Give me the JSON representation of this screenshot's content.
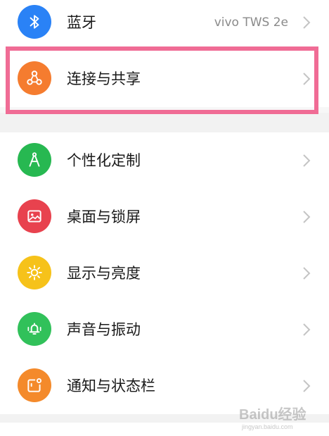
{
  "colors": {
    "bluetooth": "#2a82f6",
    "connection": "#f57c2f",
    "personalization": "#27b851",
    "desktop": "#e8424e",
    "display": "#f6c21a",
    "sound": "#31c15a",
    "notification": "#f48a2b",
    "highlight": "#f06c95"
  },
  "rows": [
    {
      "label": "蓝牙",
      "value": "vivo TWS 2e",
      "icon": "bluetooth-icon"
    },
    {
      "label": "连接与共享",
      "icon": "share-link-icon"
    },
    {
      "label": "个性化定制",
      "icon": "compass-icon"
    },
    {
      "label": "桌面与锁屏",
      "icon": "image-icon"
    },
    {
      "label": "显示与亮度",
      "icon": "sun-icon"
    },
    {
      "label": "声音与振动",
      "icon": "bell-vibration-icon"
    },
    {
      "label": "通知与状态栏",
      "icon": "notification-icon"
    }
  ],
  "watermark": {
    "text": "Baidu经验",
    "subtext": "jingyan.baidu.com"
  }
}
